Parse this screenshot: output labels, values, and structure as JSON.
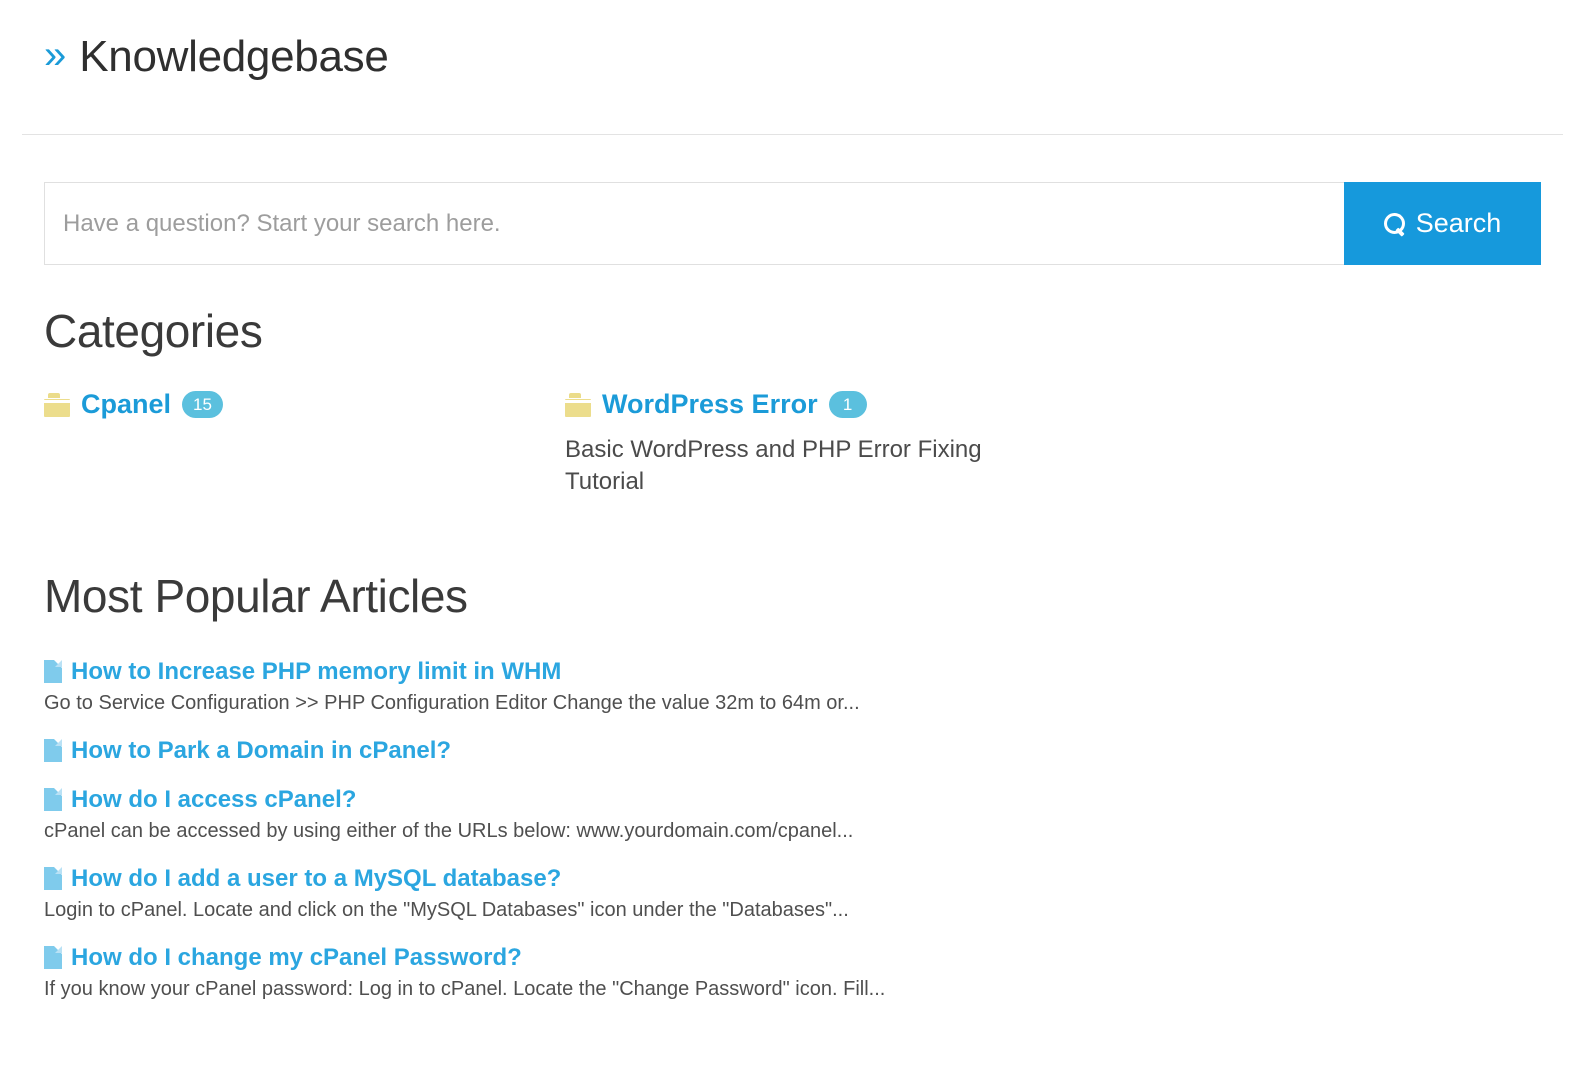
{
  "header": {
    "chevron_icon": "double-chevron-right-icon",
    "title": "Knowledgebase"
  },
  "search": {
    "placeholder": "Have a question? Start your search here.",
    "value": "",
    "button_label": "Search",
    "button_icon": "search-icon",
    "button_color": "#1699dc"
  },
  "categories": {
    "heading": "Categories",
    "items": [
      {
        "icon": "folder-icon",
        "name": "Cpanel",
        "count": "15",
        "description": ""
      },
      {
        "icon": "folder-icon",
        "name": "WordPress Error",
        "count": "1",
        "description": "Basic WordPress and PHP Error Fixing Tutorial"
      }
    ]
  },
  "popular_articles": {
    "heading": "Most Popular Articles",
    "items": [
      {
        "icon": "document-icon",
        "title": "How to Increase PHP memory limit in WHM",
        "excerpt": "Go to Service Configuration >> PHP Configuration Editor Change the value 32m to 64m or..."
      },
      {
        "icon": "document-icon",
        "title": "How to Park a Domain in cPanel?",
        "excerpt": ""
      },
      {
        "icon": "document-icon",
        "title": "How do I access cPanel?",
        "excerpt": "cPanel can be accessed by using either of the URLs below: www.yourdomain.com/cpanel..."
      },
      {
        "icon": "document-icon",
        "title": "How do I add a user to a MySQL database?",
        "excerpt": "Login to cPanel. Locate and click on the \"MySQL Databases\" icon under the \"Databases\"..."
      },
      {
        "icon": "document-icon",
        "title": "How do I change my cPanel Password?",
        "excerpt": "If you know your cPanel password: Log in to cPanel. Locate the \"Change Password\" icon. Fill..."
      }
    ]
  },
  "colors": {
    "link_blue": "#2ba6e0",
    "accent_blue": "#1b9bd8",
    "badge_blue": "#5bc0de",
    "folder_yellow": "#ecdd8c",
    "doc_blue": "#7fcbec"
  }
}
